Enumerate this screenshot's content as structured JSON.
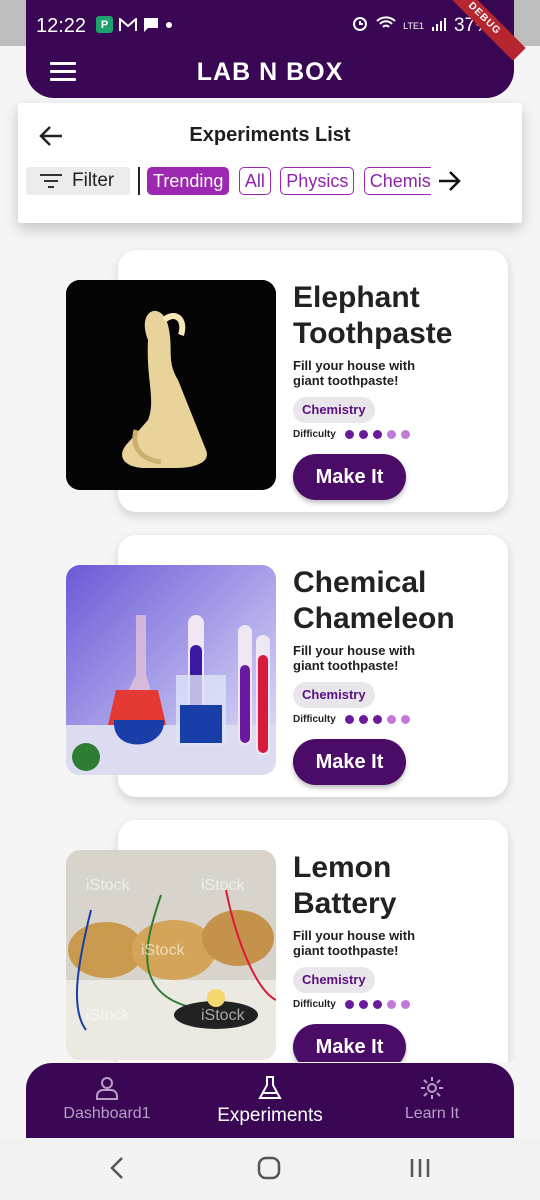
{
  "status_bar": {
    "time": "12:22",
    "battery": "37%",
    "network": "LTE1",
    "debug": "DEBUG"
  },
  "header": {
    "title": "LAB N BOX"
  },
  "subheader": {
    "title": "Experiments List",
    "filter_label": "Filter",
    "chips": [
      "Trending",
      "All",
      "Physics",
      "Chemis"
    ]
  },
  "experiments": [
    {
      "title": "Elephant Toothpaste",
      "desc": "Fill your house with giant toothpaste!",
      "tag": "Chemistry",
      "difficulty_label": "Difficulty",
      "difficulty": 3,
      "button": "Make It"
    },
    {
      "title": "Chemical Chameleon",
      "desc": "Fill your house with giant toothpaste!",
      "tag": "Chemistry",
      "difficulty_label": "Difficulty",
      "difficulty": 3,
      "button": "Make It"
    },
    {
      "title": "Lemon Battery",
      "desc": "Fill your house with giant toothpaste!",
      "tag": "Chemistry",
      "difficulty_label": "Difficulty",
      "difficulty": 3,
      "button": "Make It"
    }
  ],
  "watermark": "iStock",
  "bottom_nav": [
    {
      "label": "Dashboard1",
      "icon": "person-icon",
      "active": false
    },
    {
      "label": "Experiments",
      "icon": "flask-icon",
      "active": true
    },
    {
      "label": "Learn It",
      "icon": "gear-icon",
      "active": false
    }
  ],
  "colors": {
    "primary": "#3a0755",
    "chip": "#9c27b0",
    "button": "#4a0c66",
    "dot_filled": "#6a1b9a",
    "dot_empty": "#c27ad8"
  }
}
